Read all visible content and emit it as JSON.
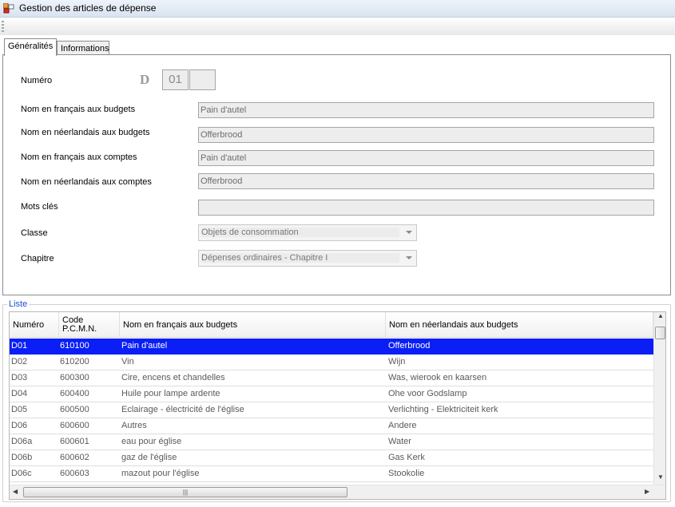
{
  "window": {
    "title": "Gestion des articles de dépense"
  },
  "tabs": [
    {
      "label": "Généralités",
      "active": true
    },
    {
      "label": "Informations",
      "active": false
    }
  ],
  "form": {
    "numero": {
      "label": "Numéro",
      "prefix": "D",
      "code": "01",
      "suffix": ""
    },
    "nom_fr_budgets": {
      "label": "Nom en français aux budgets",
      "value": "Pain d'autel"
    },
    "nom_nl_budgets": {
      "label": "Nom en néerlandais aux budgets",
      "value": "Offerbrood"
    },
    "nom_fr_comptes": {
      "label": "Nom en français aux comptes",
      "value": "Pain d'autel"
    },
    "nom_nl_comptes": {
      "label": "Nom en néerlandais aux comptes",
      "value": "Offerbrood"
    },
    "mots_cles": {
      "label": "Mots clés",
      "value": ""
    },
    "classe": {
      "label": "Classe",
      "value": "Objets de consommation"
    },
    "chapitre": {
      "label": "Chapitre",
      "value": "Dépenses ordinaires - Chapitre I"
    }
  },
  "list": {
    "title": "Liste",
    "columns": [
      "Numéro",
      "Code P.C.M.N.",
      "Nom en français aux budgets",
      "Nom en néerlandais aux budgets"
    ],
    "rows": [
      [
        "D01",
        "610100",
        "Pain d'autel",
        "Offerbrood"
      ],
      [
        "D02",
        "610200",
        "Vin",
        "Wijn"
      ],
      [
        "D03",
        "600300",
        "Cire, encens et chandelles",
        "Was, wierook en kaarsen"
      ],
      [
        "D04",
        "600400",
        "Huile pour lampe ardente",
        "Ohe voor Godslamp"
      ],
      [
        "D05",
        "600500",
        "Eclairage - électricité de l'église",
        "Verlichting - Elektriciteit kerk"
      ],
      [
        "D06",
        "600600",
        "Autres",
        "Andere"
      ],
      [
        "D06a",
        "600601",
        "eau pour église",
        "Water"
      ],
      [
        "D06b",
        "600602",
        "gaz de l'église",
        "Gas Kerk"
      ],
      [
        "D06c",
        "600603",
        "mazout pour l'église",
        "Stookolie"
      ]
    ],
    "selected_row": 0
  },
  "colors": {
    "selection": "#0a1ef5",
    "group_title": "#1a4fd6"
  }
}
